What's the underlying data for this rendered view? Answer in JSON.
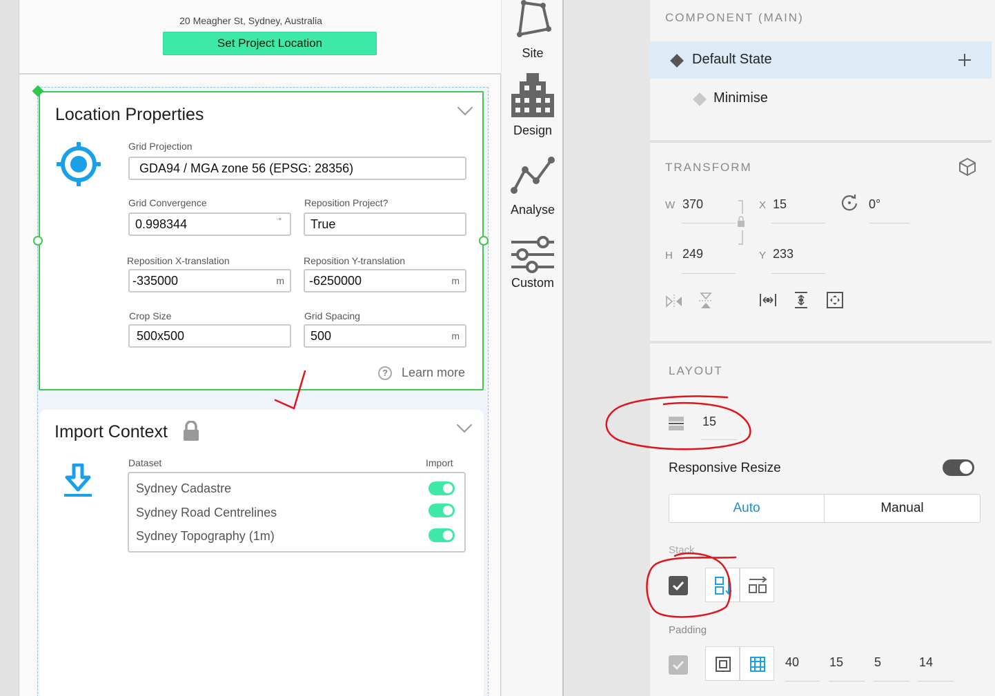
{
  "canvas": {
    "header": {
      "address": "20 Meagher St, Sydney, Australia",
      "set_location_label": "Set Project Location"
    },
    "location_card": {
      "title": "Location Properties",
      "grid_projection": {
        "label": "Grid Projection",
        "value": "GDA94 / MGA zone 56 (EPSG: 28356)"
      },
      "grid_convergence": {
        "label": "Grid Convergence",
        "value": "0.998344",
        "unit": "°"
      },
      "reposition_project": {
        "label": "Reposition Project?",
        "value": "True"
      },
      "reposition_x": {
        "label": "Reposition X-translation",
        "value": "-335000",
        "unit": "m"
      },
      "reposition_y": {
        "label": "Reposition Y-translation",
        "value": "-6250000",
        "unit": "m"
      },
      "crop_size": {
        "label": "Crop Size",
        "value": "500x500"
      },
      "grid_spacing": {
        "label": "Grid Spacing",
        "value": "500",
        "unit": "m"
      },
      "learn_more": "Learn more",
      "help_glyph": "?"
    },
    "import_card": {
      "title": "Import Context",
      "dataset_header": "Dataset",
      "import_header": "Import",
      "datasets": [
        {
          "name": "Sydney Cadastre",
          "import": true
        },
        {
          "name": "Sydney Road Centrelines",
          "import": true
        },
        {
          "name": "Sydney Topography (1m)",
          "import": true
        }
      ]
    }
  },
  "toolbar": {
    "site": "Site",
    "design": "Design",
    "analyse": "Analyse",
    "custom": "Custom"
  },
  "inspector": {
    "component_title": "COMPONENT (MAIN)",
    "states": [
      "Default State",
      "Minimise"
    ],
    "transform_title": "TRANSFORM",
    "transform": {
      "w_label": "W",
      "w": "370",
      "h_label": "H",
      "h": "249",
      "x_label": "X",
      "x": "15",
      "y_label": "Y",
      "y": "233",
      "rotation": "0°"
    },
    "layout_title": "LAYOUT",
    "spacing": "15",
    "responsive_resize_label": "Responsive Resize",
    "responsive_resize_on": true,
    "resize_modes": [
      "Auto",
      "Manual"
    ],
    "resize_mode_selected": "Auto",
    "stack_label": "Stack",
    "padding_label": "Padding",
    "padding": [
      "40",
      "15",
      "5",
      "14"
    ]
  },
  "colors": {
    "accent_green": "#3ee8a6",
    "selection_green": "#3fc84a",
    "accent_blue": "#1aa0e8",
    "annotation_red": "#e0141e",
    "selected_state_bg": "#dcebf5"
  }
}
